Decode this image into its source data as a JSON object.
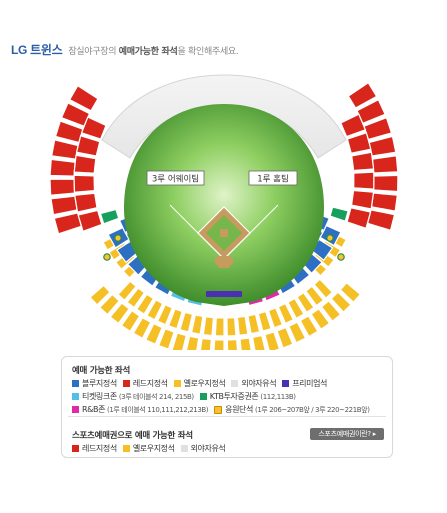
{
  "header": {
    "team": "LG 트윈스",
    "subtitle_pre": "잠실야구장의 ",
    "subtitle_bold": "예매가능한 좌석",
    "subtitle_post": "을 확인해주세요."
  },
  "field": {
    "third_base_label": "3루 어웨이팀",
    "first_base_label": "1루 홈팀"
  },
  "colors": {
    "blue": "#2d6fc2",
    "red": "#d9261c",
    "yellow": "#f5c026",
    "gray": "#e0e0e0",
    "purple": "#4b2fb4",
    "skyblue": "#54c0e6",
    "green": "#17a05d",
    "magenta": "#e02aa8",
    "grass": "#5aa83a",
    "brand": "#2b5ea7"
  },
  "legend": {
    "title": "예매 가능한 좌석",
    "row1": [
      {
        "label": "블루지정석",
        "color": "#2d6fc2"
      },
      {
        "label": "레드지정석",
        "color": "#d9261c"
      },
      {
        "label": "옐로우지정석",
        "color": "#f5c026"
      },
      {
        "label": "외야자유석",
        "color": "#e0e0e0"
      },
      {
        "label": "프리미엄석",
        "color": "#4b2fb4"
      }
    ],
    "row2": [
      {
        "label": "티켓링크존",
        "note": "(3루 테이블석 214, 215B)",
        "color": "#54c0e6"
      },
      {
        "label": "KTB투자증권존",
        "note": "(112,113B)",
        "color": "#17a05d"
      }
    ],
    "row3": [
      {
        "label": "R&B존",
        "note": "(1루 테이블석 110,111,212,213B)",
        "color": "#e02aa8"
      },
      {
        "label": "응원단석",
        "note": "(1루 206~207B앞 / 3루 220~221B앞)",
        "color": "#f7c331"
      }
    ],
    "sports_title": "스포츠예매권으로 예매 가능한 좌석",
    "sports_button": "스포츠예매권이란? ▸",
    "row4": [
      {
        "label": "레드지정석",
        "color": "#d9261c"
      },
      {
        "label": "옐로우지정석",
        "color": "#f5c026"
      },
      {
        "label": "외야자유석",
        "color": "#e0e0e0"
      }
    ]
  }
}
